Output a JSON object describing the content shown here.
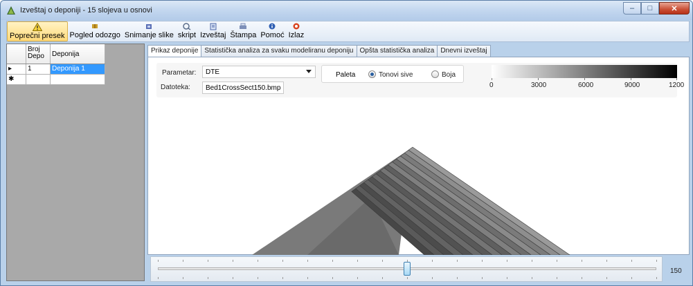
{
  "window": {
    "title": "Izveštaj o deponiji - 15 slojeva u osnovi",
    "controls": [
      "minimize-icon",
      "maximize-icon",
      "close-icon"
    ]
  },
  "toolbar": {
    "items": [
      {
        "label": "Poprečni presek",
        "icon": "warning-triangle-icon",
        "active": true
      },
      {
        "label": "Pogled odozgo",
        "icon": "grid-view-icon",
        "active": false
      },
      {
        "label": "Snimanje slike",
        "icon": "camera-icon",
        "active": false
      },
      {
        "label": "skript",
        "icon": "script-icon",
        "active": false
      },
      {
        "label": "Izveštaj",
        "icon": "report-icon",
        "active": false
      },
      {
        "label": "Štampa",
        "icon": "printer-icon",
        "active": false
      },
      {
        "label": "Pomoć",
        "icon": "help-icon",
        "active": false
      },
      {
        "label": "Izlaz",
        "icon": "exit-icon",
        "active": false
      }
    ]
  },
  "grid": {
    "headers": [
      "Broj Depo",
      "Deponija"
    ],
    "rows": [
      {
        "marker": "▸",
        "broj": "1",
        "deponija": "Deponija 1",
        "selected": true
      },
      {
        "marker": "✱",
        "broj": "",
        "deponija": "",
        "selected": false
      }
    ]
  },
  "tabs": [
    {
      "label": "Prikaz deponije",
      "active": true
    },
    {
      "label": "Statistička analiza za svaku modeliranu deponiju",
      "active": false
    },
    {
      "label": "Opšta statistička analiza",
      "active": false
    },
    {
      "label": "Dnevni izveštaj",
      "active": false
    }
  ],
  "params": {
    "parametar_label": "Parametar:",
    "parametar_value": "DTE",
    "datoteka_label": "Datoteka:",
    "datoteka_value": "Bed1CrossSect150.bmp"
  },
  "palette": {
    "label": "Paleta",
    "options": [
      {
        "label": "Tonovi sive",
        "selected": true
      },
      {
        "label": "Boja",
        "selected": false
      }
    ],
    "scale": {
      "ticks": [
        "0",
        "3000",
        "6000",
        "9000",
        "1200"
      ],
      "min_color": "#ffffff",
      "max_color": "#000000"
    }
  },
  "cross_section": {
    "layer_count": 15,
    "layer_shades": [
      "#9a9a9a",
      "#8e8e8e",
      "#7b7b7b",
      "#8a8a8a",
      "#6d6d6d",
      "#7f7f7f",
      "#5f5f5f",
      "#747474",
      "#595959",
      "#6a6a6a",
      "#525252",
      "#636363",
      "#4c4c4c",
      "#5a5a5a",
      "#474747"
    ]
  },
  "slider": {
    "value": "150",
    "position_fraction": 0.5
  }
}
